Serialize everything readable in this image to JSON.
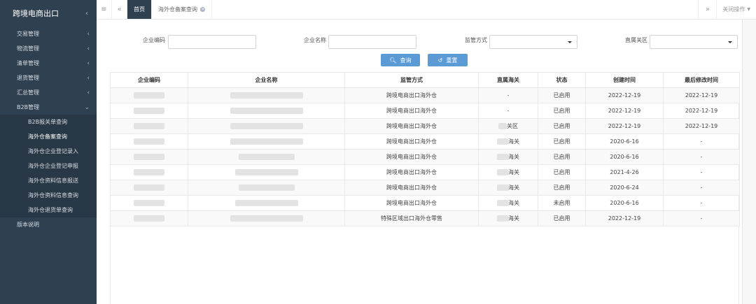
{
  "sidebar": {
    "app_title": "跨境电商出口",
    "collapse_icon": "chevron-left-icon",
    "menu": [
      {
        "label": "交易管理"
      },
      {
        "label": "物流管理"
      },
      {
        "label": "清单管理"
      },
      {
        "label": "退货管理"
      },
      {
        "label": "汇总管理"
      },
      {
        "label": "B2B管理"
      }
    ],
    "b2b_submenu": [
      {
        "label": "B2B报关单查询"
      },
      {
        "label": "海外仓备案查询"
      },
      {
        "label": "海外仓企业登记录入"
      },
      {
        "label": "海外仓企业登记申报"
      },
      {
        "label": "海外仓资料信息报送"
      },
      {
        "label": "海外仓资料信息查询"
      },
      {
        "label": "海外仓退货单查询"
      }
    ],
    "version_label": "版本说明"
  },
  "topbar": {
    "home_tab": "首页",
    "current_tab": "海外仓备案查询",
    "close_ops": "关闭操作"
  },
  "search": {
    "enterprise_code_label": "企业编码",
    "enterprise_name_label": "企业名称",
    "supervision_mode_label": "监管方式",
    "customs_label": "直属关区",
    "enterprise_code_value": "",
    "enterprise_name_value": "",
    "supervision_mode_value": "",
    "customs_value": "",
    "query_label": "查询",
    "reset_label": "重置"
  },
  "table": {
    "headers": [
      "企业编码",
      "企业名称",
      "监管方式",
      "直属海关",
      "状态",
      "创建时间",
      "最后修改时间"
    ],
    "rows": [
      {
        "mode": "跨境电商出口海外仓",
        "customs": "-",
        "status": "已启用",
        "created": "2022-12-19",
        "modified": "2022-12-19"
      },
      {
        "mode": "跨境电商出口海外仓",
        "customs": "-",
        "status": "已启用",
        "created": "2022-12-19",
        "modified": "2022-12-19"
      },
      {
        "mode": "跨境电商出口海外仓",
        "customs": "关区",
        "status": "已启用",
        "created": "2022-12-19",
        "modified": "2022-12-19"
      },
      {
        "mode": "跨境电商出口海外仓",
        "customs": "海关",
        "status": "已启用",
        "created": "2020-6-16",
        "modified": "-"
      },
      {
        "mode": "跨境电商出口海外仓",
        "customs": "海关",
        "status": "已启用",
        "created": "2020-6-16",
        "modified": "-"
      },
      {
        "mode": "跨境电商出口海外仓",
        "customs": "海关",
        "status": "已启用",
        "created": "2021-4-26",
        "modified": "-"
      },
      {
        "mode": "跨境电商出口海外仓",
        "customs": "海关",
        "status": "已启用",
        "created": "2020-6-24",
        "modified": "-"
      },
      {
        "mode": "跨境电商出口海外仓",
        "customs": "海关",
        "status": "未启用",
        "created": "2020-6-16",
        "modified": "-"
      },
      {
        "mode": "特殊区域出口海外仓零售",
        "customs": "海关",
        "status": "已启用",
        "created": "2022-12-19",
        "modified": "-"
      }
    ]
  }
}
